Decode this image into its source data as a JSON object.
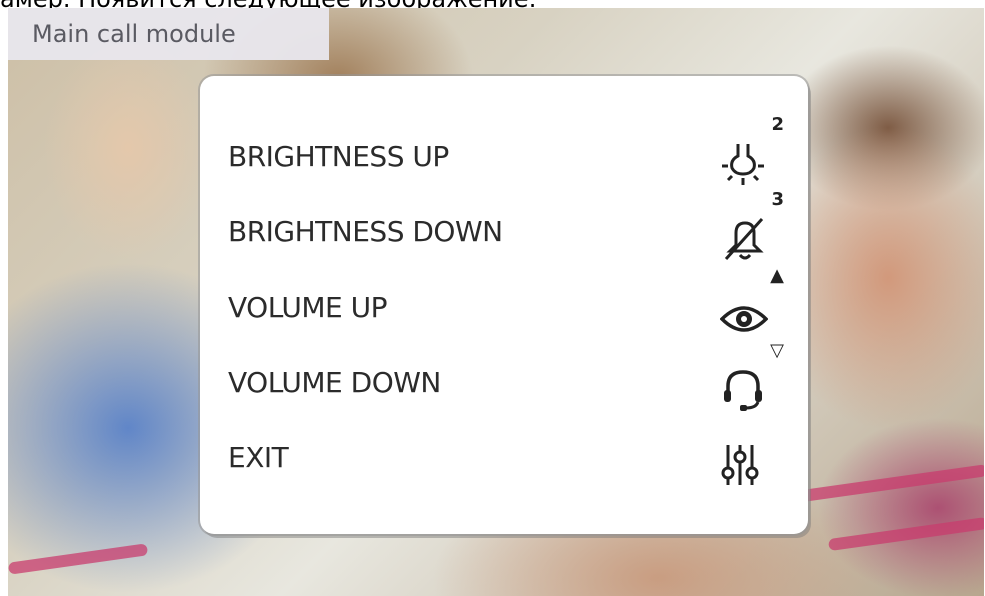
{
  "top_caption": "амер. Появится следующее изображение:",
  "source_label": "Main call module",
  "menu": {
    "items": [
      {
        "label": "BRIGHTNESS UP",
        "icon": "light-bulb-icon",
        "mark": "2"
      },
      {
        "label": "BRIGHTNESS DOWN",
        "icon": "bell-off-icon",
        "mark": "3"
      },
      {
        "label": "VOLUME UP",
        "icon": "eye-icon",
        "mark": "▲"
      },
      {
        "label": "VOLUME DOWN",
        "icon": "headset-icon",
        "mark": "▽"
      },
      {
        "label": "EXIT",
        "icon": "settings-sliders-icon",
        "mark": ""
      }
    ]
  },
  "colors": {
    "panel": "#ffffff",
    "label_bg": "#e8e6ec",
    "text": "#2b2b2b"
  }
}
